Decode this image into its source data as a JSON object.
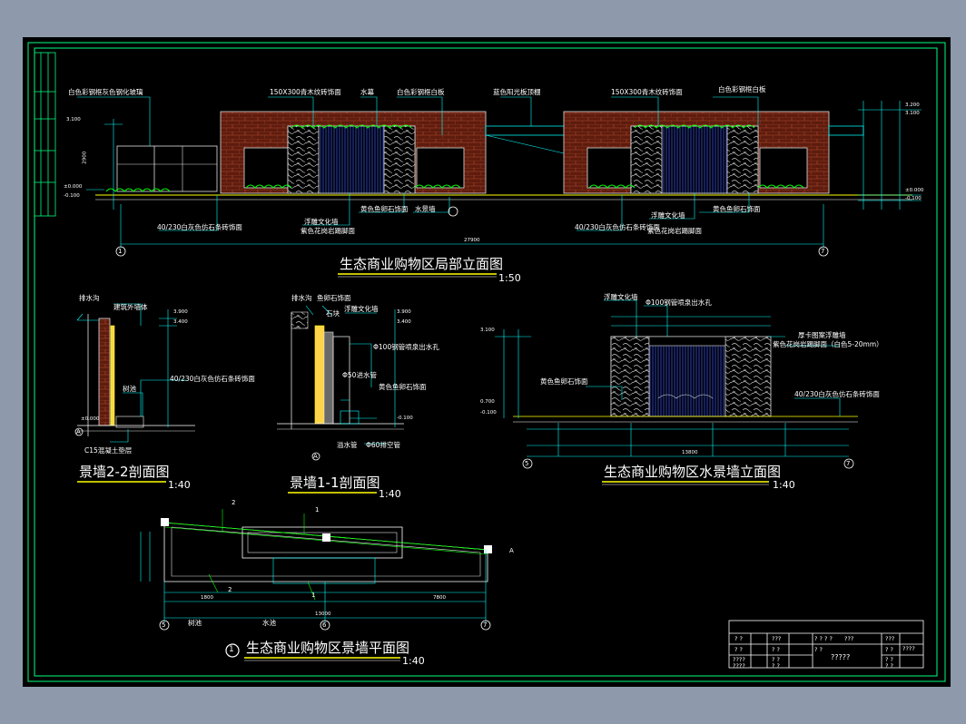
{
  "drawing": {
    "title_main": "生态商业购物区局部立面图",
    "scale_main": "1:50",
    "title_sec22": "景墙2-2剖面图",
    "scale_sec22": "1:40",
    "title_sec11": "景墙1-1剖面图",
    "scale_sec11": "1:40",
    "title_water": "生态商业购物区水景墙立面图",
    "scale_water": "1:40",
    "title_plan": "生态商业购物区景墙平面图",
    "plan_number": "1",
    "scale_plan": "1:40"
  },
  "labels": {
    "white_wall_glass": "白色彩钢框灰色钢化玻璃",
    "paving_300": "150X300青木纹砖饰面",
    "water_curtain": "水幕",
    "white_frame": "白色彩钢框白板",
    "blue_canopy": "蓝色阳光板顶棚",
    "white_frame_r": "白色彩钢框白板",
    "paving_300_r": "150X300青木纹砖饰面",
    "granite_base": "40/230白灰色仿石条砖饰面",
    "granite_base_r": "40/230白灰色仿石条砖饰面",
    "relief_wall": "浮雕文化墙",
    "relief_wall_r": "浮雕文化墙",
    "purple_paint": "紫色花岗岩踢脚面",
    "purple_paint_r": "紫色花岗岩踢脚面",
    "yellow_stone": "黄色鱼卵石饰面",
    "yellow_stone_r": "黄色鱼卵石饰面",
    "water_channel": "水景墙",
    "drain": "排水沟",
    "building_wall": "建筑外墙体",
    "planting": "树池",
    "concrete_base": "C15混凝土垫层",
    "drain2": "排水沟",
    "stone_facing": "鱼卵石饰面",
    "stone_head": "石块",
    "relief_wall2": "浮雕文化墙",
    "pipe100": "Φ100钢管喷泉出水孔",
    "pipe50": "Φ50进水管",
    "yellow_stone2": "黄色鱼卵石饰面",
    "overflow": "溢水管",
    "pipe60": "Φ60排空管",
    "relief_wall3": "浮雕文化墙",
    "pipe100_w": "Φ100钢管喷泉出水孔",
    "yellow_stone3": "黄色鱼卵石饰面",
    "right_note1": "厚卡图案浮雕墙",
    "right_note2": "紫色花岗岩踢脚面（白色5-20mm）",
    "granite_base3": "40/230白灰色仿石条砖饰面",
    "planting_plan": "树池",
    "water_plan": "水池",
    "plan_c": "ⓒ"
  },
  "grid_refs": {
    "e1": "1",
    "e7": "7",
    "sA1": "A",
    "sA2": "A",
    "w5": "5",
    "w7": "7",
    "p5": "5",
    "p6": "6",
    "p7": "7",
    "c2a": "2",
    "c2b": "2",
    "c1a": "1",
    "c1b": "1",
    "cA": "A"
  },
  "dims": {
    "total_main": "27900",
    "e_3100": "3.100",
    "e_2900": "2900",
    "e_000": "±0.000",
    "e_m010": "-0.100",
    "r_3200": "3.200",
    "r_3100": "3.100",
    "r_000": "±0.000",
    "r_m010": "-0.100",
    "s22_3900": "3.900",
    "s22_3400": "3.400",
    "s22_000": "±0.000",
    "s11_3900": "3.900",
    "s11_3400": "3.400",
    "s11_m010": "-0.100",
    "w_3100": "3.100",
    "w_0700": "0.700",
    "w_m010": "-0.100",
    "w_total": "13800",
    "p_1800": "1800",
    "p_13000": "13000",
    "p_7800": "7800"
  },
  "title_block": {
    "r1": [
      "? ?",
      "???",
      "? ? ? ?",
      "???",
      "???"
    ],
    "r2": [
      "? ?",
      "? ?",
      "? ?",
      "? ?"
    ],
    "r3": [
      "????",
      "? ?",
      "?????",
      "? ?",
      "????"
    ],
    "r4": [
      "????",
      "? ?",
      "? ?"
    ]
  },
  "colors": {
    "cad_cyan": "#00ffff",
    "cad_green": "#00ff00",
    "cad_yellow": "#ffff00",
    "cad_red": "#ff0000",
    "cad_white": "#ffffff",
    "brick": "#7a2412",
    "sheet_bg": "#000000",
    "outer_bg": "#8e9aab"
  }
}
